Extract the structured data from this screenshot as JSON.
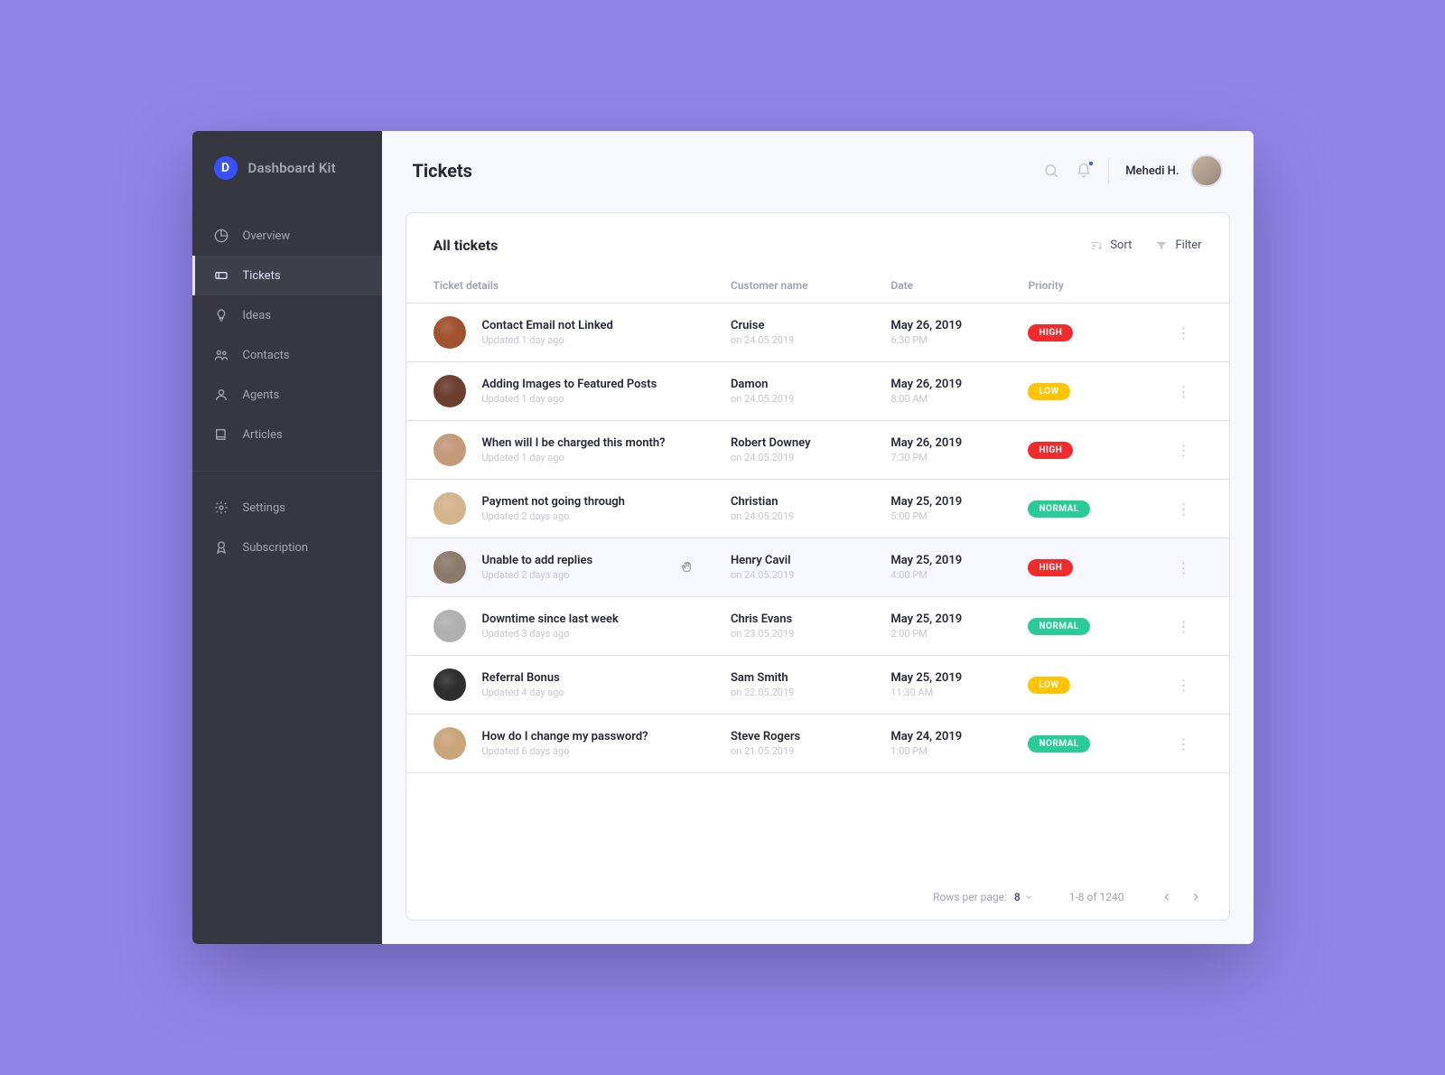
{
  "brand": {
    "name": "Dashboard Kit",
    "logo_letter": "D"
  },
  "sidebar": {
    "primary": [
      {
        "label": "Overview",
        "icon": "pie"
      },
      {
        "label": "Tickets",
        "icon": "ticket",
        "active": true
      },
      {
        "label": "Ideas",
        "icon": "bulb"
      },
      {
        "label": "Contacts",
        "icon": "people"
      },
      {
        "label": "Agents",
        "icon": "person"
      },
      {
        "label": "Articles",
        "icon": "book"
      }
    ],
    "secondary": [
      {
        "label": "Settings",
        "icon": "gear"
      },
      {
        "label": "Subscription",
        "icon": "badge"
      }
    ]
  },
  "header": {
    "title": "Tickets",
    "user_name": "Mehedi H."
  },
  "card": {
    "title": "All tickets",
    "sort_label": "Sort",
    "filter_label": "Filter",
    "columns": {
      "details": "Ticket details",
      "customer": "Customer name",
      "date": "Date",
      "priority": "Priority"
    }
  },
  "tickets": [
    {
      "title": "Contact Email not Linked",
      "updated": "Updated 1 day ago",
      "customer": "Cruise",
      "customer_sub": "on 24.05.2019",
      "date": "May 26, 2019",
      "time": "6:30 PM",
      "priority": "HIGH"
    },
    {
      "title": "Adding Images to Featured Posts",
      "updated": "Updated 1 day ago",
      "customer": "Damon",
      "customer_sub": "on 24.05.2019",
      "date": "May 26, 2019",
      "time": "8:00 AM",
      "priority": "LOW"
    },
    {
      "title": "When will I be charged this month?",
      "updated": "Updated 1 day ago",
      "customer": "Robert Downey",
      "customer_sub": "on 24.05.2019",
      "date": "May 26, 2019",
      "time": "7:30 PM",
      "priority": "HIGH"
    },
    {
      "title": "Payment not going through",
      "updated": "Updated 2 days ago",
      "customer": "Christian",
      "customer_sub": "on 24.05.2019",
      "date": "May 25, 2019",
      "time": "5:00 PM",
      "priority": "NORMAL"
    },
    {
      "title": "Unable to add replies",
      "updated": "Updated 2 days ago",
      "customer": "Henry Cavil",
      "customer_sub": "on 24.05.2019",
      "date": "May 25, 2019",
      "time": "4:00 PM",
      "priority": "HIGH",
      "hovered": true
    },
    {
      "title": "Downtime since last week",
      "updated": "Updated 3 days ago",
      "customer": "Chris Evans",
      "customer_sub": "on 23.05.2019",
      "date": "May 25, 2019",
      "time": "2:00 PM",
      "priority": "NORMAL"
    },
    {
      "title": "Referral Bonus",
      "updated": "Updated 4 day ago",
      "customer": "Sam Smith",
      "customer_sub": "on 22.05.2019",
      "date": "May 25, 2019",
      "time": "11:30 AM",
      "priority": "LOW"
    },
    {
      "title": "How do I change my password?",
      "updated": "Updated 6 days ago",
      "customer": "Steve Rogers",
      "customer_sub": "on 21.05.2019",
      "date": "May 24, 2019",
      "time": "1:00 PM",
      "priority": "NORMAL"
    }
  ],
  "pager": {
    "rows_label": "Rows per page:",
    "rows_value": "8",
    "range": "1-8 of 1240"
  },
  "avatar_colors": [
    "#a0522d",
    "#6b3e2e",
    "#c49a7b",
    "#d4b48c",
    "#8a7a6a",
    "#b0b0b0",
    "#2e2e2e",
    "#caa57a"
  ]
}
